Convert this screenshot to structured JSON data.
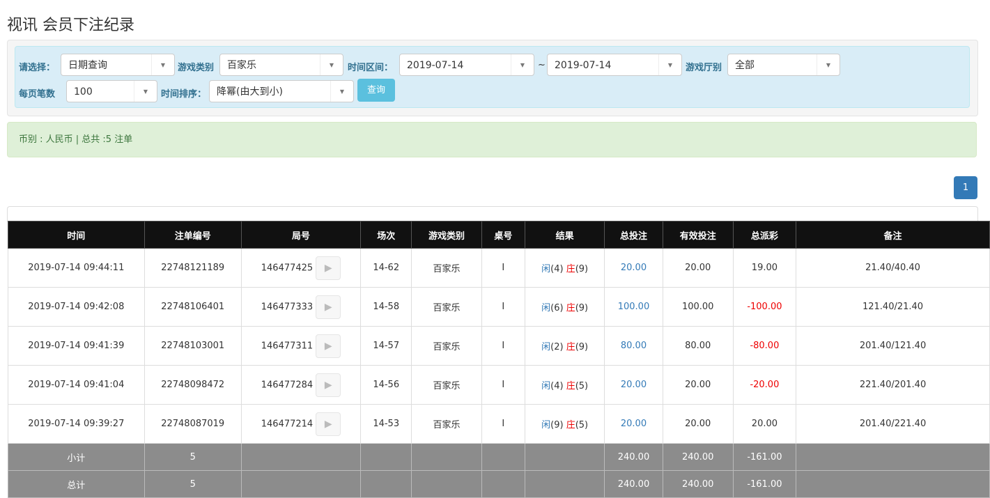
{
  "title": "视讯 会员下注纪录",
  "filters": {
    "select_label": "请选择：",
    "select_value": "日期查询",
    "game_type_label": "游戏类别",
    "game_type_value": "百家乐",
    "range_label": "时间区间：",
    "date_from": "2019-07-14",
    "tilde": "~",
    "date_to": "2019-07-14",
    "hall_label": "游戏厅别",
    "hall_value": "全部",
    "per_page_label": "每页笔数",
    "per_page_value": "100",
    "sort_label": "时间排序：",
    "sort_value": "降幂(由大到小)",
    "query_button": "查询"
  },
  "info": "币别 : 人民币 | 总共 :5 注单",
  "pagination": {
    "current": "1"
  },
  "table": {
    "headers": [
      "时间",
      "注单编号",
      "局号",
      "场次",
      "游戏类别",
      "桌号",
      "结果",
      "总投注",
      "有效投注",
      "总派彩",
      "备注"
    ],
    "rows": [
      {
        "time": "2019-07-14 09:44:11",
        "bet_id": "22748121189",
        "round": "146477425",
        "session": "14-62",
        "game": "百家乐",
        "table": "I",
        "player": "闲",
        "player_pts": "(4)",
        "banker": "庄",
        "banker_pts": "(9)",
        "bet": "20.00",
        "valid": "20.00",
        "payout": "19.00",
        "payout_neg": false,
        "note": "21.40/40.40"
      },
      {
        "time": "2019-07-14 09:42:08",
        "bet_id": "22748106401",
        "round": "146477333",
        "session": "14-58",
        "game": "百家乐",
        "table": "I",
        "player": "闲",
        "player_pts": "(6)",
        "banker": "庄",
        "banker_pts": "(9)",
        "bet": "100.00",
        "valid": "100.00",
        "payout": "-100.00",
        "payout_neg": true,
        "note": "121.40/21.40"
      },
      {
        "time": "2019-07-14 09:41:39",
        "bet_id": "22748103001",
        "round": "146477311",
        "session": "14-57",
        "game": "百家乐",
        "table": "I",
        "player": "闲",
        "player_pts": "(2)",
        "banker": "庄",
        "banker_pts": "(9)",
        "bet": "80.00",
        "valid": "80.00",
        "payout": "-80.00",
        "payout_neg": true,
        "note": "201.40/121.40"
      },
      {
        "time": "2019-07-14 09:41:04",
        "bet_id": "22748098472",
        "round": "146477284",
        "session": "14-56",
        "game": "百家乐",
        "table": "I",
        "player": "闲",
        "player_pts": "(4)",
        "banker": "庄",
        "banker_pts": "(5)",
        "bet": "20.00",
        "valid": "20.00",
        "payout": "-20.00",
        "payout_neg": true,
        "note": "221.40/201.40"
      },
      {
        "time": "2019-07-14 09:39:27",
        "bet_id": "22748087019",
        "round": "146477214",
        "session": "14-53",
        "game": "百家乐",
        "table": "I",
        "player": "闲",
        "player_pts": "(9)",
        "banker": "庄",
        "banker_pts": "(5)",
        "bet": "20.00",
        "valid": "20.00",
        "payout": "20.00",
        "payout_neg": false,
        "note": "201.40/221.40"
      }
    ],
    "subtotal": {
      "label": "小计",
      "count": "5",
      "bet": "240.00",
      "valid": "240.00",
      "payout": "-161.00"
    },
    "total": {
      "label": "总计",
      "count": "5",
      "bet": "240.00",
      "valid": "240.00",
      "payout": "-161.00"
    }
  }
}
